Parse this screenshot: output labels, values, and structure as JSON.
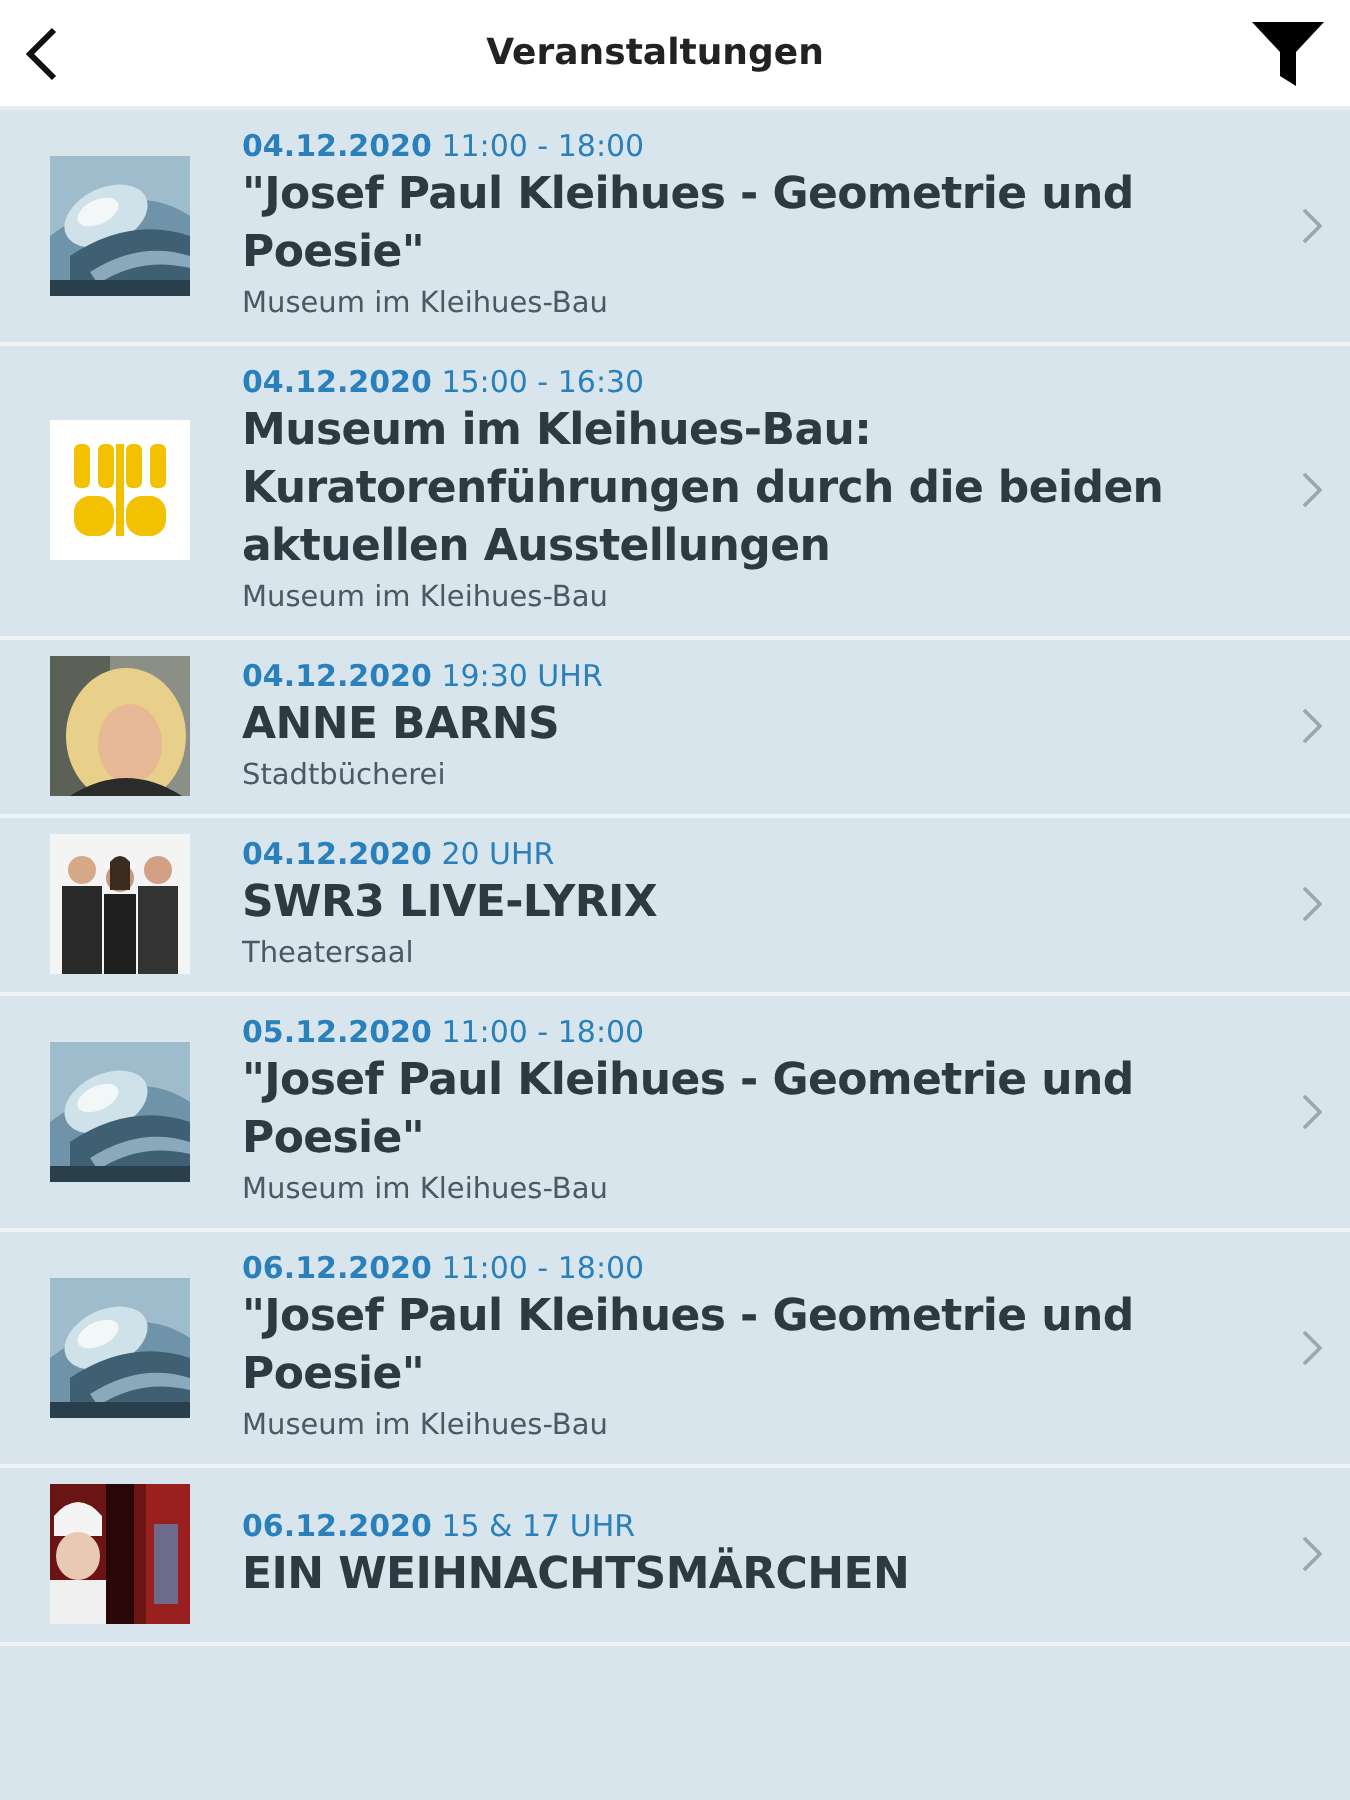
{
  "header": {
    "title": "Veranstaltungen"
  },
  "events": [
    {
      "date": "04.12.2020",
      "time": "11:00 - 18:00",
      "title": "\"Josef Paul Kleihues - Geometrie und Poesie\"",
      "venue": "Museum im Kleihues-Bau",
      "thumbnail": {
        "kind": "architecture"
      }
    },
    {
      "date": "04.12.2020",
      "time": "15:00 - 16:30",
      "title": "Museum im Kleihues-Bau: Kuratorenführungen durch die beiden aktuellen Ausstellungen",
      "venue": "Museum im Kleihues-Bau",
      "thumbnail": {
        "kind": "logo"
      }
    },
    {
      "date": "04.12.2020",
      "time": "19:30 UHR",
      "title": "ANNE BARNS",
      "venue": "Stadtbücherei",
      "thumbnail": {
        "kind": "portrait"
      }
    },
    {
      "date": "04.12.2020",
      "time": "20 UHR",
      "title": "SWR3 LIVE-LYRIX",
      "venue": "Theatersaal",
      "thumbnail": {
        "kind": "group"
      }
    },
    {
      "date": "05.12.2020",
      "time": "11:00 - 18:00",
      "title": "\"Josef Paul Kleihues - Geometrie und Poesie\"",
      "venue": "Museum im Kleihues-Bau",
      "thumbnail": {
        "kind": "architecture"
      }
    },
    {
      "date": "06.12.2020",
      "time": "11:00 - 18:00",
      "title": "\"Josef Paul Kleihues - Geometrie und Poesie\"",
      "venue": "Museum im Kleihues-Bau",
      "thumbnail": {
        "kind": "architecture"
      }
    },
    {
      "date": "06.12.2020",
      "time": "15 & 17 UHR",
      "title": "EIN WEIHNACHTSMÄRCHEN",
      "thumbnail": {
        "kind": "stage"
      }
    }
  ]
}
